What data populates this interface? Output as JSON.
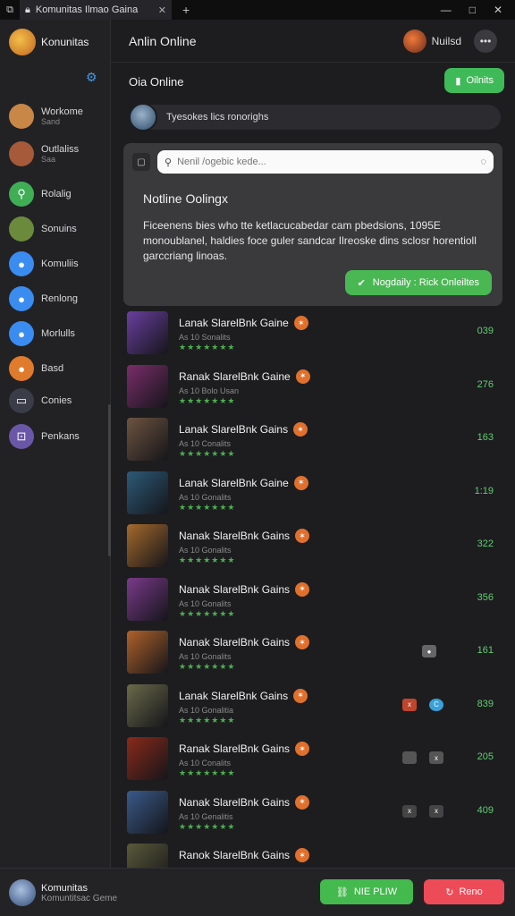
{
  "titlebar": {
    "tab_label": "Komunitas Ilmao Gaina",
    "controls": [
      "—",
      "□",
      "✕"
    ]
  },
  "sidebar": {
    "brand": "Konunitas",
    "items": [
      {
        "label": "Workome",
        "sub": "Sand",
        "color": "#c88746"
      },
      {
        "label": "Outlaliss",
        "sub": "Saa",
        "color": "#a65a3a"
      },
      {
        "label": "Rolalig",
        "sub": "",
        "color": "#3fae55"
      },
      {
        "label": "Sonuins",
        "sub": "",
        "color": "#6c8a3c"
      },
      {
        "label": "Komuliis",
        "sub": "",
        "color": "#3a8cf0"
      },
      {
        "label": "Renlong",
        "sub": "",
        "color": "#3a8cf0"
      },
      {
        "label": "Morlulls",
        "sub": "",
        "color": "#3a8cf0"
      },
      {
        "label": "Basd",
        "sub": "",
        "color": "#e07a2c"
      },
      {
        "label": "Conies",
        "sub": "",
        "color": "#3a3d48"
      },
      {
        "label": "Penkans",
        "sub": "",
        "color": "#6b57a8"
      }
    ]
  },
  "header": {
    "title": "Anlin Online",
    "user_name": "Nuilsd"
  },
  "main": {
    "section_title": "Oia Online",
    "online_button": "Oilnits",
    "status_text": "Tyesokes lics ronorighs"
  },
  "card": {
    "search_placeholder": "Nenil /ogebic kede...",
    "title": "Notline Oolingx",
    "body": "Ficeenens bies who tte ketlacucabedar cam pbedsions, 1095E monoublanel, haldies foce guler sandcar Ilreoske dins sclosr horentioll garccriang linoas.",
    "action_label": "Nogdaily : Rick Onleiltes"
  },
  "games": [
    {
      "title": "Lanak SlarelBnk Gaine",
      "sub": "As 10 Sonalits",
      "stars": "★★★★★★★",
      "count": "039",
      "thumb": "#6a3fa0",
      "minis": []
    },
    {
      "title": "Ranak SlarelBnk Gaine",
      "sub": "As 10 Bolo Usan",
      "stars": "★★★★★★★",
      "count": "276",
      "thumb": "#7a2d6a",
      "minis": []
    },
    {
      "title": "Lanak SlarelBnk Gains",
      "sub": "As 10 Conalits",
      "stars": "★★★★★★★",
      "count": "163",
      "thumb": "#6e5440",
      "minis": []
    },
    {
      "title": "Lanak SlarelBnk Gaine",
      "sub": "As 10 Gonalits",
      "stars": "★★★★★★★",
      "count": "1:19",
      "thumb": "#2d5a78",
      "minis": []
    },
    {
      "title": "Nanak SlarelBnk Gains",
      "sub": "As 10 Gonalits",
      "stars": "★★★★★★★",
      "count": "322",
      "thumb": "#a56a2c",
      "minis": []
    },
    {
      "title": "Nanak SlarelBnk Gains",
      "sub": "As 10 Gonalits",
      "stars": "★★★★★★★",
      "count": "356",
      "thumb": "#7a3a8a",
      "minis": []
    },
    {
      "title": "Nanak SlarelBnk Gains",
      "sub": "As 10 Gonalits",
      "stars": "★★★★★★★",
      "count": "161",
      "thumb": "#b0622a",
      "minis": [
        {
          "color": "#666",
          "text": "●"
        }
      ]
    },
    {
      "title": "Lanak SlarelBnk Gains",
      "sub": "As 10 Gonalitia",
      "stars": "★★★★★★★",
      "count": "839",
      "thumb": "#6a6a4a",
      "minis": [
        {
          "color": "#c0452c",
          "text": "x"
        },
        {
          "color": "#3aa0d8",
          "text": "C"
        }
      ]
    },
    {
      "title": "Ranak SlarelBnk Gains",
      "sub": "As 10 Conalits",
      "stars": "★★★★★★★",
      "count": "205",
      "thumb": "#8a2a1a",
      "minis": [
        {
          "color": "#555",
          "text": ""
        },
        {
          "color": "#555",
          "text": "x"
        }
      ]
    },
    {
      "title": "Nanak SlarelBnk Gains",
      "sub": "As 10 Genalitis",
      "stars": "★★★★★★★",
      "count": "409",
      "thumb": "#3a5a8a",
      "minis": [
        {
          "color": "#444",
          "text": "x"
        },
        {
          "color": "#444",
          "text": "x"
        }
      ]
    },
    {
      "title": "Ranok SlarelBnk Gains",
      "sub": "",
      "stars": "",
      "count": "",
      "thumb": "#5a5a3a",
      "minis": []
    }
  ],
  "footer": {
    "name": "Komunitas",
    "sub": "Komuntitsac Geme",
    "new_button": "NIE PLIW",
    "reno_button": "Reno"
  }
}
